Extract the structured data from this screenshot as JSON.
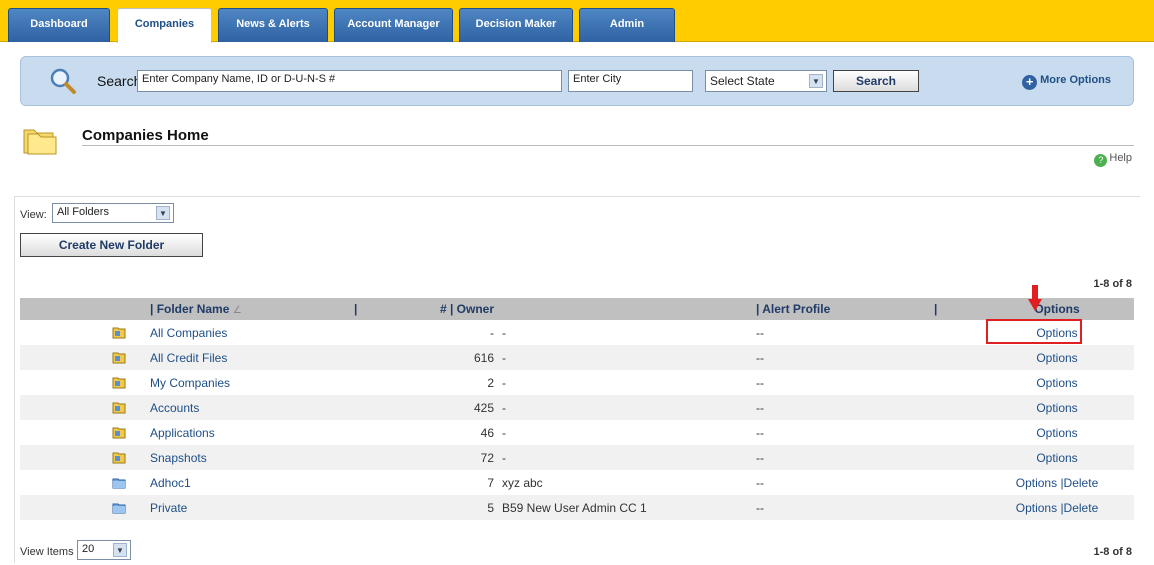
{
  "nav": {
    "tabs": [
      {
        "label": "Dashboard"
      },
      {
        "label": "Companies"
      },
      {
        "label": "News & Alerts"
      },
      {
        "label": "Account Manager"
      },
      {
        "label": "Decision Maker"
      },
      {
        "label": "Admin"
      }
    ],
    "active_tab": "Companies"
  },
  "search": {
    "label": "Search",
    "company_value": "Enter Company Name, ID or D-U-N-S #",
    "city_value": "Enter City",
    "state_selected": "Select State",
    "button_label": "Search",
    "more_options_label": "More Options"
  },
  "page": {
    "title": "Companies Home",
    "help_label": "Help"
  },
  "controls": {
    "view_label": "View:",
    "view_selected": "All Folders",
    "create_button_label": "Create New Folder",
    "count_top": "1-8 of 8",
    "count_bottom": "1-8 of 8",
    "view_items_label": "View Items",
    "view_items_selected": "20"
  },
  "table": {
    "headers": {
      "folder_name": "| Folder Name",
      "count": "# | Owner",
      "sep1": "|",
      "alert_profile": "| Alert Profile",
      "sep2": "|",
      "options": "Options"
    },
    "rows": [
      {
        "name": "All Companies",
        "count": "-",
        "owner": "-",
        "alert": "--",
        "options": "Options",
        "delete": "",
        "icon": "shared-folder-icon"
      },
      {
        "name": "All Credit Files",
        "count": "616",
        "owner": "-",
        "alert": "--",
        "options": "Options",
        "delete": "",
        "icon": "shared-folder-icon"
      },
      {
        "name": "My Companies",
        "count": "2",
        "owner": "-",
        "alert": "--",
        "options": "Options",
        "delete": "",
        "icon": "shared-folder-icon"
      },
      {
        "name": "Accounts",
        "count": "425",
        "owner": "-",
        "alert": "--",
        "options": "Options",
        "delete": "",
        "icon": "shared-folder-icon"
      },
      {
        "name": "Applications",
        "count": "46",
        "owner": "-",
        "alert": "--",
        "options": "Options",
        "delete": "",
        "icon": "shared-folder-icon"
      },
      {
        "name": "Snapshots",
        "count": "72",
        "owner": "-",
        "alert": "--",
        "options": "Options",
        "delete": "",
        "icon": "shared-folder-icon"
      },
      {
        "name": "Adhoc1",
        "count": "7",
        "owner": "xyz abc",
        "alert": "--",
        "options": "Options",
        "delete": "|Delete",
        "icon": "blue-folder-icon"
      },
      {
        "name": "Private",
        "count": "5",
        "owner": "B59 New User Admin CC 1",
        "alert": "--",
        "options": "Options",
        "delete": "|Delete",
        "icon": "blue-folder-icon"
      }
    ]
  },
  "colors": {
    "topbar": "#ffcc00",
    "tab": "#2f62a3",
    "search_panel": "#c9dcef",
    "link": "#1f4f87",
    "highlight": "#e02020",
    "header_row": "#c0c0c0"
  }
}
